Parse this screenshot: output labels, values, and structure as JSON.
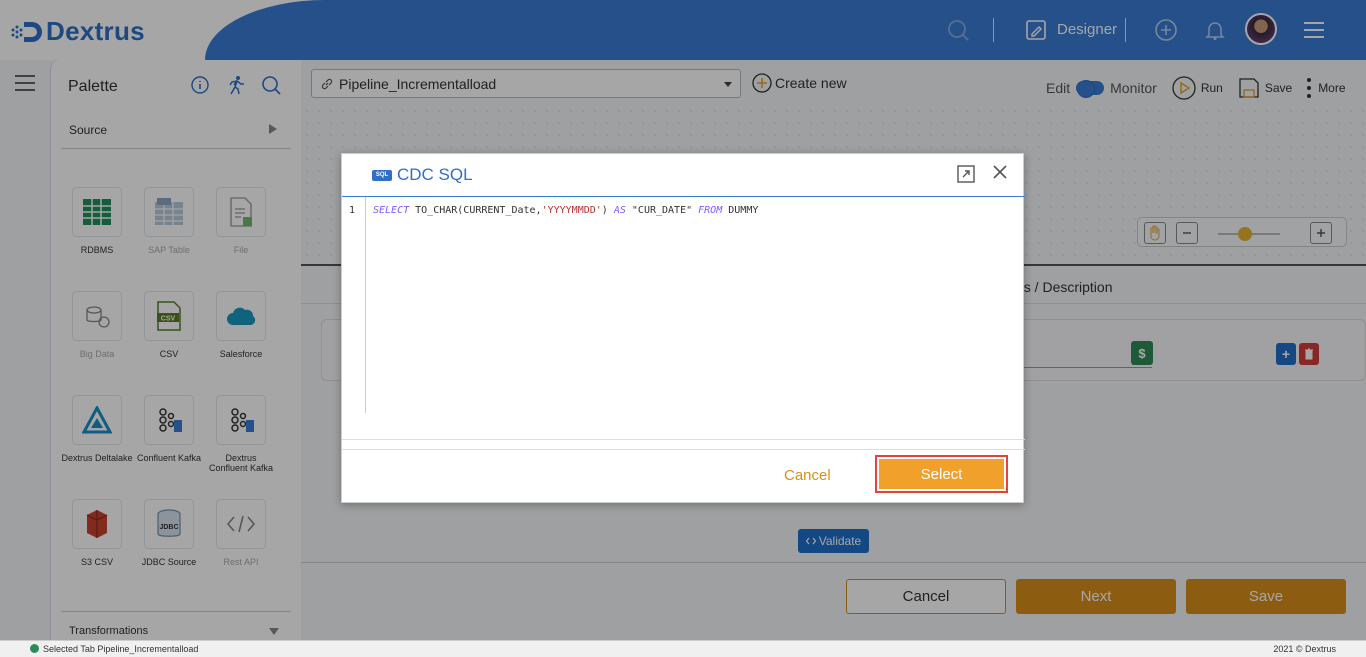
{
  "app": {
    "brand": "Dextrus",
    "designer_label": "Designer"
  },
  "palette": {
    "title": "Palette",
    "source_label": "Source",
    "transformations_label": "Transformations",
    "tiles": [
      {
        "label": "RDBMS",
        "icon": "rdbms-icon",
        "dim": false
      },
      {
        "label": "SAP Table",
        "icon": "sap-table-icon",
        "dim": true
      },
      {
        "label": "File",
        "icon": "file-icon",
        "dim": true
      },
      {
        "label": "Big Data",
        "icon": "big-data-icon",
        "dim": true
      },
      {
        "label": "CSV",
        "icon": "csv-icon",
        "dim": false
      },
      {
        "label": "Salesforce",
        "icon": "salesforce-icon",
        "dim": false
      },
      {
        "label": "Dextrus Deltalake",
        "icon": "deltalake-icon",
        "dim": false
      },
      {
        "label": "Confluent Kafka",
        "icon": "kafka-icon",
        "dim": false
      },
      {
        "label": "Dextrus Confluent Kafka",
        "icon": "dextrus-kafka-icon",
        "dim": false
      },
      {
        "label": "S3 CSV",
        "icon": "s3-csv-icon",
        "dim": false
      },
      {
        "label": "JDBC Source",
        "icon": "jdbc-icon",
        "dim": false
      },
      {
        "label": "Rest API",
        "icon": "rest-api-icon",
        "dim": true
      }
    ]
  },
  "toolbar": {
    "pipeline_value": "Pipeline_Incrementalload",
    "create_new": "Create new",
    "edit": "Edit",
    "monitor": "Monitor",
    "run": "Run",
    "save": "Save",
    "more": "More"
  },
  "panel": {
    "tab_description": "ns / Description",
    "validate": "Validate",
    "cancel": "Cancel",
    "next": "Next",
    "save": "Save"
  },
  "modal": {
    "title": "CDC SQL",
    "badge": "SQL",
    "line_number": "1",
    "code": {
      "kw_select": "SELECT",
      "part1": " TO_CHAR(CURRENT_Date,",
      "literal": "'YYYYMMDD'",
      "part2": ") ",
      "kw_as": "AS",
      "part3": " \"CUR_DATE\" ",
      "kw_from": "FROM",
      "part4": " DUMMY"
    },
    "cancel": "Cancel",
    "select": "Select"
  },
  "status": {
    "text": "Selected Tab Pipeline_Incrementalload",
    "copyright": "2021 © Dextrus"
  },
  "colors": {
    "brand_blue": "#3a7bd5",
    "accent_orange": "#f0a02b",
    "highlight_red": "#e0443a"
  }
}
